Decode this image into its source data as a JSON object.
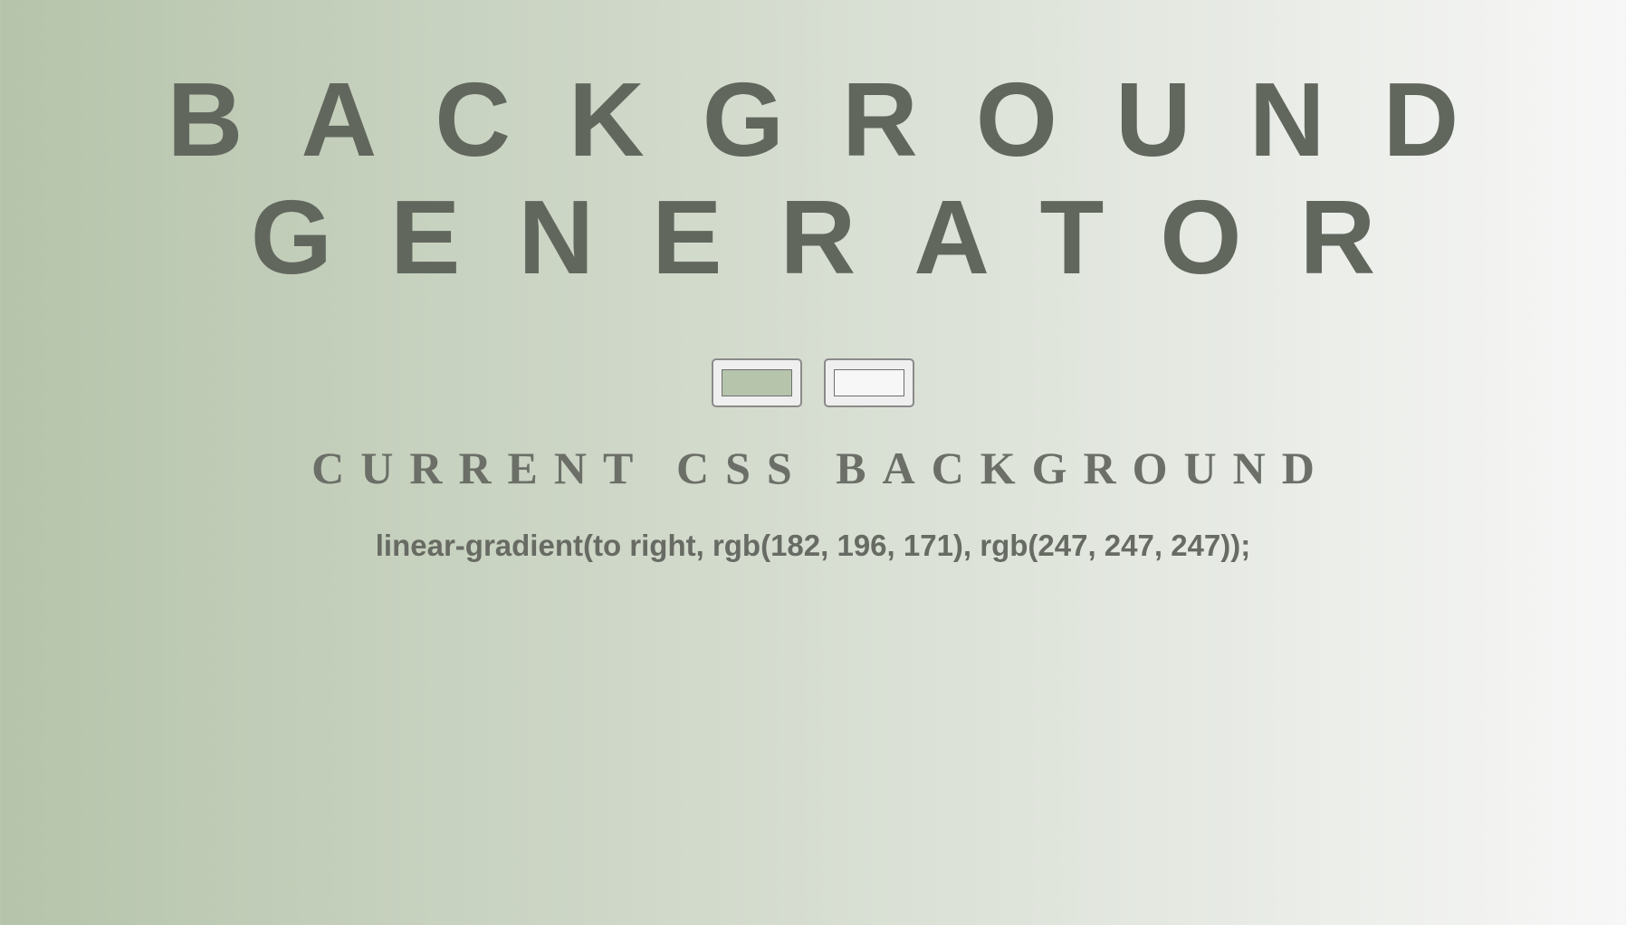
{
  "header": {
    "title_line1": "BACKGROUND",
    "title_line2": "GENERATOR"
  },
  "pickers": [
    {
      "value": "#b6c4ab"
    },
    {
      "value": "#f7f7f7"
    }
  ],
  "subtitle": "CURRENT CSS BACKGROUND",
  "css_output": "linear-gradient(to right, rgb(182, 196, 171), rgb(247, 247, 247));",
  "colors": {
    "gradient_start": "#b6c4ab",
    "gradient_end": "#f7f7f7",
    "text": "#62675e"
  }
}
